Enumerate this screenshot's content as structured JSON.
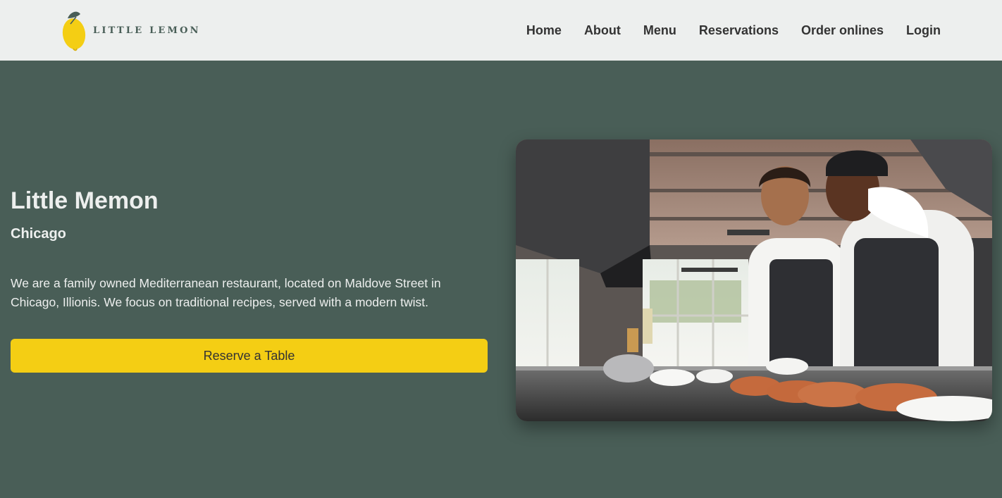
{
  "header": {
    "logo": {
      "text": "LITTLE LEMON",
      "icon": "lemon-icon"
    },
    "nav": [
      {
        "label": "Home"
      },
      {
        "label": "About"
      },
      {
        "label": "Menu"
      },
      {
        "label": "Reservations"
      },
      {
        "label": "Order onlines"
      },
      {
        "label": "Login"
      }
    ]
  },
  "hero": {
    "title": "Little Memon",
    "subtitle": "Chicago",
    "description": "We are a family owned Mediterranean restaurant, located on Maldove Street in Chicago, Illionis. We focus on traditional recipes, served with a modern twist.",
    "cta_label": "Reserve a Table",
    "image": "chefs-in-kitchen-photo"
  },
  "colors": {
    "primary_green": "#495e57",
    "primary_yellow": "#f4ce14",
    "header_bg": "#edefee",
    "nav_text": "#333333",
    "hero_text": "#edefee"
  }
}
